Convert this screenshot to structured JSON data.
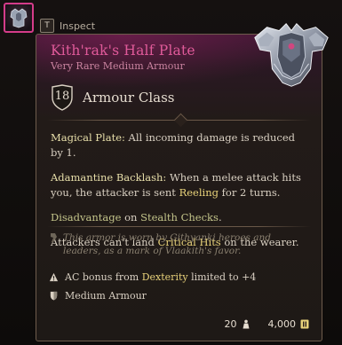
{
  "inspect": {
    "key": "T",
    "label": "Inspect"
  },
  "item": {
    "name": "Kith'rak's Half Plate",
    "rarity_type": "Very Rare Medium Armour",
    "armour_class_value": "18",
    "armour_class_label": "Armour Class",
    "name_color": "#e05a9a"
  },
  "effects": {
    "magical_plate_name": "Magical Plate:",
    "magical_plate_text": " All incoming damage is reduced by 1.",
    "backlash_name": "Adamantine Backlash:",
    "backlash_text_1": " When a melee attack hits you, the attacker is sent ",
    "backlash_keyword": "Reeling",
    "backlash_text_2": " for 2 turns.",
    "disadvantage_word": "Disadvantage",
    "disadvantage_on": " on ",
    "disadvantage_target": "Stealth Checks",
    "disadvantage_end": ".",
    "crit_text_1": "Attackers can't land ",
    "crit_keyword": "Critical Hits",
    "crit_text_2": " on the wearer."
  },
  "lore": "This armor is worn by Githyanki heroes and leaders, as a mark of Vlaakith's favor.",
  "properties": {
    "dex_prefix": "AC bonus from ",
    "dex_keyword": "Dexterity",
    "dex_suffix": " limited to +4",
    "category": "Medium Armour"
  },
  "footer": {
    "weight": "20",
    "price": "4,000"
  },
  "icons": {
    "slot": "armour-slot-icon",
    "shield": "shield-icon",
    "lore": "quote-icon",
    "warning": "warning-icon",
    "category": "medium-armour-icon",
    "weight": "weight-icon",
    "gold": "gold-coin-icon"
  }
}
